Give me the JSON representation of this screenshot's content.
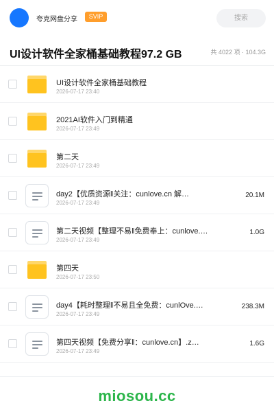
{
  "header": {
    "user_name": "夸克网盘分享",
    "badge": "SVIP",
    "search_placeholder": "搜索",
    "avatar_color": "#1677ff",
    "badge_color": "#ff9e2c"
  },
  "share": {
    "title": "UI设计软件全家桶基础教程97.2 GB",
    "meta": "共 4022 项 · 104.3G"
  },
  "items": [
    {
      "type": "folder",
      "icon": "folder-icon",
      "name": "UI设计软件全家桶基础教程",
      "date": "2026-07-17 23:40",
      "size": ""
    },
    {
      "type": "folder",
      "icon": "folder-icon",
      "name": "2021AI软件入门到精通",
      "date": "2026-07-17 23:49",
      "size": ""
    },
    {
      "type": "folder",
      "icon": "folder-icon",
      "name": "第二天",
      "date": "2026-07-17 23:49",
      "size": ""
    },
    {
      "type": "file",
      "icon": "file-icon",
      "name": "day2【优质资源‖关注：cunlove.cn 解…",
      "date": "2026-07-17 23:49",
      "size": "20.1M"
    },
    {
      "type": "file",
      "icon": "file-icon",
      "name": "第二天视频【整理不易‖免费奉上：cunlove.c…",
      "date": "2026-07-17 23:49",
      "size": "1.0G"
    },
    {
      "type": "folder",
      "icon": "folder-icon",
      "name": "第四天",
      "date": "2026-07-17 23:50",
      "size": ""
    },
    {
      "type": "file",
      "icon": "file-icon",
      "name": "day4【耗时整理‖不易且全免费：cunlOve.…",
      "date": "2026-07-17 23:49",
      "size": "238.3M"
    },
    {
      "type": "file",
      "icon": "file-icon",
      "name": "第四天视频【免费分享‖：cunlove.cn】.z…",
      "date": "2026-07-17 23:49",
      "size": "1.6G"
    }
  ],
  "footer": {
    "watermark": "miosou.cc",
    "watermark_color": "#2bb54a"
  }
}
